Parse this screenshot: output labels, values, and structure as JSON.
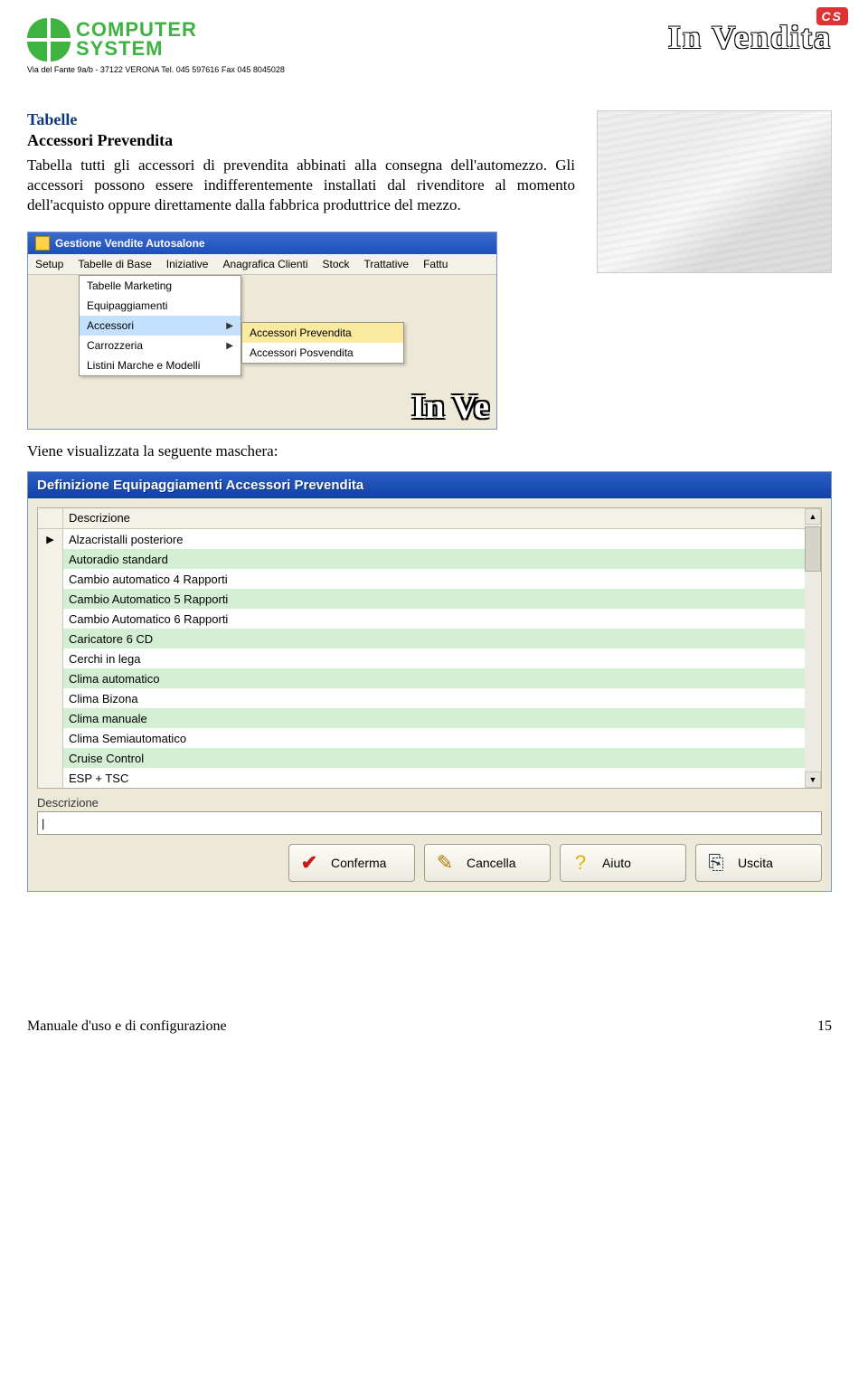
{
  "header": {
    "company_name_1": "COMPUTER",
    "company_name_2": "SYSTEM",
    "address": "Via del Fante 9a/b - 37122 VERONA  Tel. 045 597616  Fax 045 8045028",
    "brand": "In Vendita",
    "brand_badge": "CS"
  },
  "section": {
    "title1": "Tabelle",
    "title2": "Accessori Prevendita",
    "paragraph": "Tabella tutti gli accessori di prevendita abbinati alla consegna dell'automezzo. Gli accessori possono essere indifferentemente installati dal rivenditore al momento dell'acquisto oppure direttamente dalla fabbrica produttrice del mezzo."
  },
  "menu_shot": {
    "window_title": "Gestione Vendite Autosalone",
    "menubar": [
      "Setup",
      "Tabelle di Base",
      "Iniziative",
      "Anagrafica Clienti",
      "Stock",
      "Trattative",
      "Fattu"
    ],
    "dropdown": [
      {
        "label": "Tabelle Marketing",
        "has_sub": false
      },
      {
        "label": "Equipaggiamenti",
        "has_sub": false
      },
      {
        "label": "Accessori",
        "has_sub": true,
        "hl": true
      },
      {
        "label": "Carrozzeria",
        "has_sub": true
      },
      {
        "label": "Listini Marche e  Modelli",
        "has_sub": false
      }
    ],
    "submenu": [
      {
        "label": "Accessori Prevendita",
        "hl": true
      },
      {
        "label": "Accessori Posvendita",
        "hl": false
      }
    ],
    "bg_text": "In Ve"
  },
  "caption": "Viene visualizzata la seguente maschera:",
  "form_shot": {
    "title": "Definizione Equipaggiamenti Accessori Prevendita",
    "grid_header": "Descrizione",
    "rows": [
      "Alzacristalli posteriore",
      "Autoradio standard",
      "Cambio automatico 4 Rapporti",
      "Cambio Automatico 5 Rapporti",
      "Cambio Automatico 6 Rapporti",
      "Caricatore 6 CD",
      "Cerchi in lega",
      "Clima automatico",
      "Clima Bizona",
      "Clima manuale",
      "Clima Semiautomatico",
      "Cruise Control",
      "ESP + TSC"
    ],
    "desc_label": "Descrizione",
    "desc_value": "|",
    "buttons": {
      "conferma": "Conferma",
      "cancella": "Cancella",
      "aiuto": "Aiuto",
      "uscita": "Uscita"
    }
  },
  "footer": {
    "left": "Manuale d'uso e di configurazione",
    "right": "15"
  }
}
